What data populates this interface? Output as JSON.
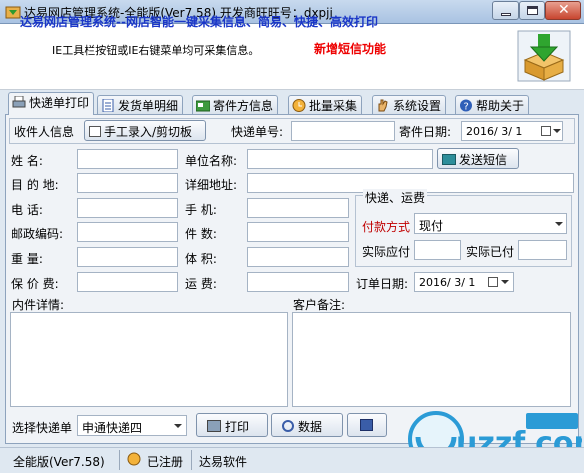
{
  "window": {
    "title": "达易网店管理系统-全能版(Ver7.58) 开发商旺旺号：dxpjj"
  },
  "banner": {
    "title": "达易网店管理系统--网店智能一键采集信息、简易、快捷、高效打印",
    "subtitle": "IE工具栏按钮或IE右键菜单均可采集信息。",
    "new_feature": "新增短信功能"
  },
  "tabs": [
    {
      "label": "快递单打印",
      "icon": "printer-icon"
    },
    {
      "label": "发货单明细",
      "icon": "document-icon"
    },
    {
      "label": "寄件方信息",
      "icon": "card-icon"
    },
    {
      "label": "批量采集",
      "icon": "clock-icon"
    },
    {
      "label": "系统设置",
      "icon": "hand-icon"
    },
    {
      "label": "帮助关于",
      "icon": "help-icon"
    }
  ],
  "row1": {
    "recipient_label": "收件人信息",
    "manual_button": "手工录入/剪切板",
    "tracking_label": "快递单号:",
    "tracking_value": "",
    "send_date_label": "寄件日期:",
    "send_date": "2016/ 3/ 1"
  },
  "fields": {
    "name_label": "姓    名:",
    "company_label": "单位名称:",
    "sms_button": "发送短信",
    "destination_label": "目 的 地:",
    "address_label": "详细地址:",
    "phone_label": "电    话:",
    "mobile_label": "手    机:",
    "zip_label": "邮政编码:",
    "pieces_label": "件    数:",
    "weight_label": "重    量:",
    "volume_label": "体    积:",
    "insurance_label": "保 价 费:",
    "freight_label": "运    费:",
    "order_date_label": "订单日期:",
    "order_date": "2016/ 3/ 1",
    "contents_label": "内件详情:",
    "remark_label": "客户备注:"
  },
  "express_fee": {
    "legend": "快递、运费",
    "payment_label": "付款方式",
    "payment_value": "现付",
    "actual_receivable_label": "实际应付",
    "actual_paid_label": "实际已付"
  },
  "bottom": {
    "choose_label": "选择快递单",
    "courier_value": "申通快递四",
    "print_button": "打印",
    "data_button": "数据"
  },
  "status": {
    "version": "全能版(Ver7.58)",
    "registered": "已注册",
    "vendor": "达易软件"
  },
  "watermark": "uzzf.com",
  "colors": {
    "banner_title": "#1a36c7",
    "new_feature": "#e00000",
    "payment_label": "#c00000"
  }
}
